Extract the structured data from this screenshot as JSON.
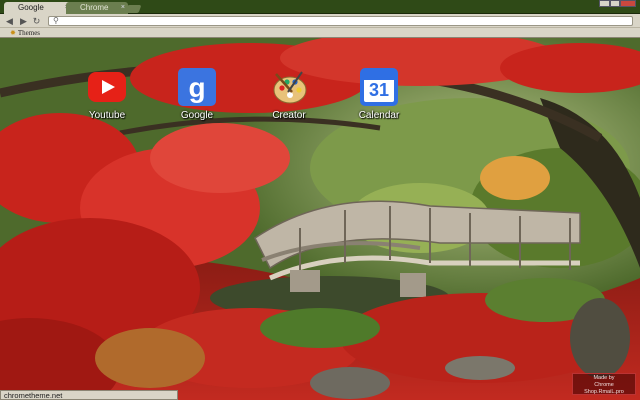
{
  "window": {
    "tabs": [
      {
        "label": "Google",
        "active": true
      },
      {
        "label": "Chrome",
        "active": false
      }
    ]
  },
  "toolbar": {
    "omnibox_value": ""
  },
  "bookmarks": {
    "items": [
      {
        "label": "Themes",
        "icon": "bookmark-star-icon"
      }
    ]
  },
  "apps": [
    {
      "label": "Youtube",
      "icon": "youtube-icon",
      "color": "#e62117"
    },
    {
      "label": "Google",
      "icon": "google-icon",
      "color": "#3b74e0"
    },
    {
      "label": "Creator",
      "icon": "palette-icon",
      "color": "#e8c27a"
    },
    {
      "label": "Calendar",
      "icon": "calendar-icon",
      "color": "#2f6fe4",
      "day": "31"
    }
  ],
  "status_bar": {
    "text": "chrometheme.net"
  },
  "watermark": {
    "lines": [
      "Made by",
      "Chrome",
      "Shop.RmaiL.pro"
    ]
  },
  "colors": {
    "frame": "#2f4a17",
    "toolbar": "#d9d5c7",
    "foliage": "#c8241c"
  }
}
